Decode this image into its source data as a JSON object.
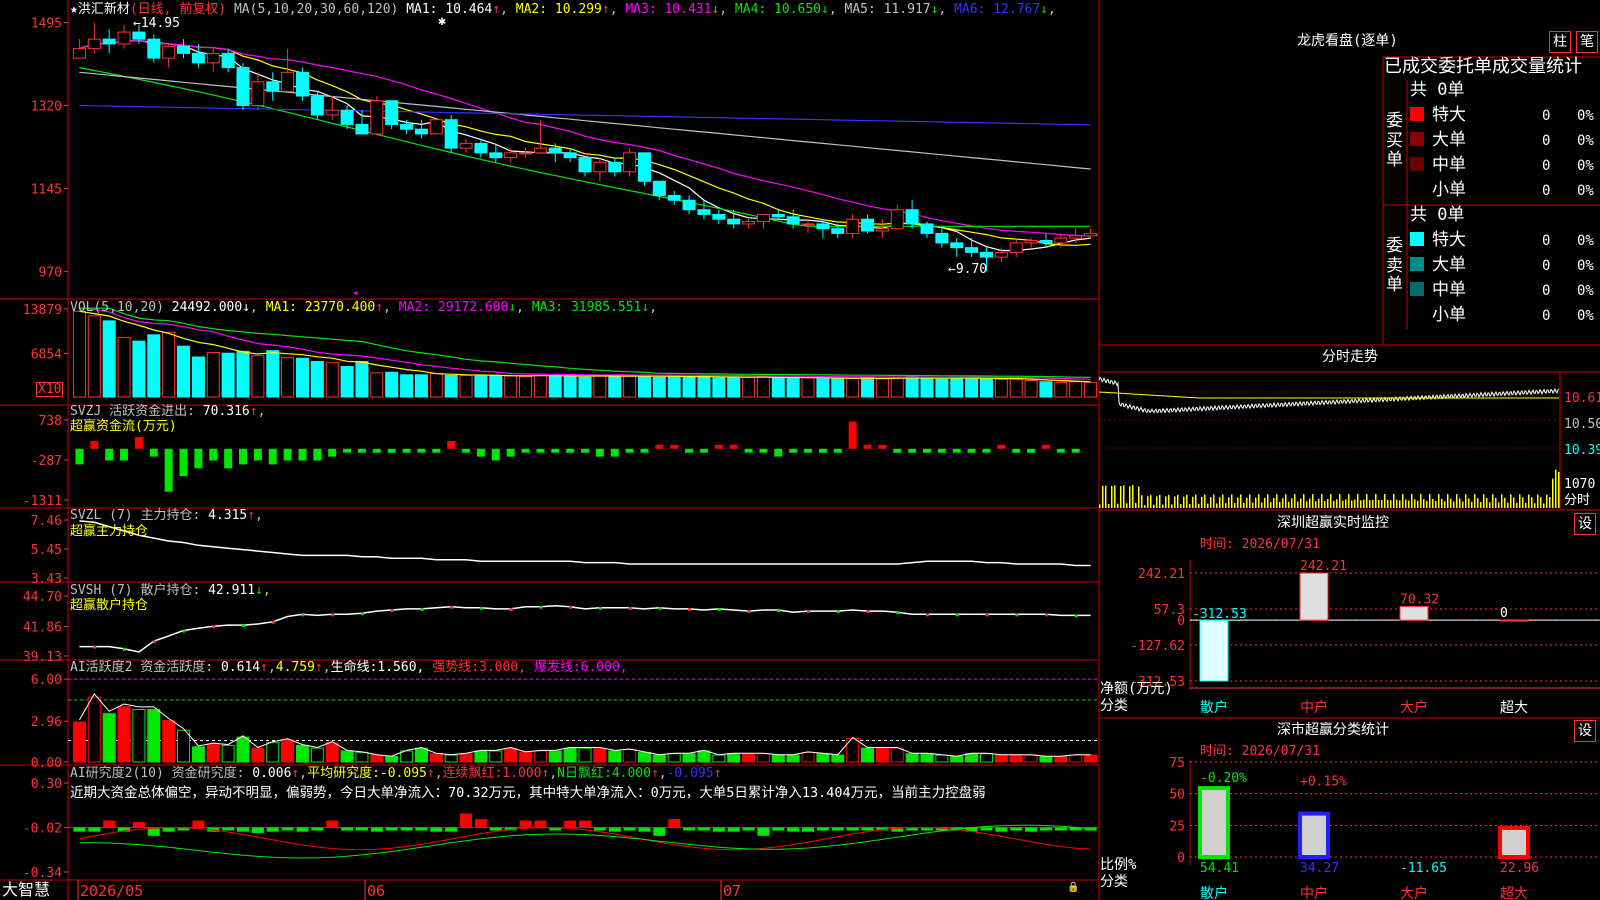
{
  "stock": {
    "star": "★",
    "name": "洪汇新材",
    "mode": "(日线, 前复权)"
  },
  "ma_header": {
    "label": "MA(5,10,20,30,60,120)",
    "items": [
      {
        "name": "MA1:",
        "value": "10.464",
        "dir": "↑",
        "color": "#ffffff"
      },
      {
        "name": "MA2:",
        "value": "10.299",
        "dir": "↑",
        "color": "#ffff00"
      },
      {
        "name": "MA3:",
        "value": "10.431",
        "dir": "↓",
        "color": "#ff00ff"
      },
      {
        "name": "MA4:",
        "value": "10.650",
        "dir": "↓",
        "color": "#00e600"
      },
      {
        "name": "MA5:",
        "value": "11.917",
        "dir": "↓",
        "color": "#c0c0c0"
      },
      {
        "name": "MA6:",
        "value": "12.767",
        "dir": "↓",
        "color": "#3232ff"
      }
    ]
  },
  "price_axis": [
    "1495",
    "1320",
    "1145",
    "970"
  ],
  "price_marks": {
    "high": "14.95",
    "low": "9.70"
  },
  "vol_header": {
    "label": "VOL(5,10,20)",
    "value": "24492.000",
    "dir": "↓",
    "items": [
      {
        "name": "MA1:",
        "value": "23770.400",
        "dir": "↑",
        "color": "#ffff00"
      },
      {
        "name": "MA2:",
        "value": "29172.600",
        "dir": "↓",
        "color": "#ff00ff"
      },
      {
        "name": "MA3:",
        "value": "31985.551",
        "dir": "↓",
        "color": "#00e600"
      }
    ]
  },
  "vol_axis": [
    "13879",
    "6854"
  ],
  "vol_unit": "X10",
  "svzj": {
    "label": "SVZJ  活跃资金进出:",
    "value": "70.316",
    "dir": "↑",
    "sub": "超赢资金流(万元)",
    "axis": [
      "738",
      "-287",
      "-1311"
    ]
  },
  "svzl": {
    "label": "SVZL (7) 主力持仓:",
    "value": "4.315",
    "dir": "↑",
    "sub": "超赢主力持仓",
    "axis": [
      "7.46",
      "5.45",
      "3.43"
    ]
  },
  "svsh": {
    "label": "SVSH (7) 散户持仓:",
    "value": "42.911",
    "dir": "↓",
    "sub": "超赢散户持仓",
    "axis": [
      "44.70",
      "41.86",
      "39.13"
    ]
  },
  "ai1": {
    "label": "AI活跃度2 资金活跃度:",
    "v1": "0.614",
    "v2": "4.759",
    "life": "生命线:",
    "life_v": "1.560,",
    "strong": "强势线:",
    "strong_v": "3.000,",
    "burst": "爆发线:",
    "burst_v": "6.000,",
    "axis": [
      "6.00",
      "2.96",
      "0.00"
    ]
  },
  "ai2": {
    "label": "AI研究度2(10) 资金研究度:",
    "v1": "0.006",
    "avg": "平均研究度:",
    "avg_v": "-0.095",
    "lx": "连续飘红:",
    "lx_v": "1.000",
    "nd": "N日飘红:",
    "nd_v": "4.000",
    "last": "-0.095",
    "axis": [
      "0.30",
      "-0.02",
      "-0.34"
    ],
    "comment": "近期大资金总体偏空，异动不明显，偏弱势，今日大单净流入：70.32万元，其中特大单净流入：0万元，大单5日累计净入13.404万元，当前主力控盘弱"
  },
  "dates": [
    "2026/05",
    "06",
    "07"
  ],
  "brand": "大智慧",
  "lhb": {
    "title": "龙虎看盘(逐单)",
    "btn1": "柱",
    "btn2": "笔",
    "tabs": "已成交委托单成交量统计",
    "buy": {
      "side": "委买单",
      "total": "共 0单",
      "rows": [
        {
          "label": "特大",
          "n": "0",
          "p": "0%",
          "color": "#ff0000"
        },
        {
          "label": "大单",
          "n": "0",
          "p": "0%",
          "color": "#8b0000"
        },
        {
          "label": "中单",
          "n": "0",
          "p": "0%",
          "color": "#6b0000"
        },
        {
          "label": "小单",
          "n": "0",
          "p": "0%",
          "color": "#000000"
        }
      ]
    },
    "sell": {
      "side": "委卖单",
      "total": "共 0单",
      "rows": [
        {
          "label": "特大",
          "n": "0",
          "p": "0%",
          "color": "#00ffff"
        },
        {
          "label": "大单",
          "n": "0",
          "p": "0%",
          "color": "#008b8b"
        },
        {
          "label": "中单",
          "n": "0",
          "p": "0%",
          "color": "#006b6b"
        },
        {
          "label": "小单",
          "n": "0",
          "p": "0%",
          "color": "#000000"
        }
      ]
    }
  },
  "fenshi": {
    "title": "分时走势",
    "axis": [
      "10.61",
      "10.50",
      "10.39"
    ],
    "vol": "1070",
    "vol_label": "分时"
  },
  "szjk": {
    "title": "深圳超赢实时监控",
    "btn": "设",
    "time": "时间: 2026/07/31",
    "axis": [
      "242.21",
      "57.3",
      "0",
      "-127.62",
      "-312.53"
    ],
    "unit": "净额(万元)",
    "cat_label": "分类",
    "categories": [
      "散户",
      "中户",
      "大户",
      "超大"
    ],
    "values": [
      "-312.53",
      "242.21",
      "70.32",
      "0"
    ]
  },
  "szfl": {
    "title": "深市超赢分类统计",
    "btn": "设",
    "time": "时间: 2026/07/31",
    "axis": [
      "75",
      "50",
      "25",
      "0"
    ],
    "unit": "比例%",
    "cat_label": "分类",
    "categories": [
      "散户",
      "中户",
      "大户",
      "超大"
    ],
    "values": [
      "54.41",
      "34.27",
      "-11.65",
      "22.96"
    ],
    "changes": [
      "-0.20%",
      "+0.15%"
    ]
  },
  "chart_data": [
    {
      "type": "candlestick",
      "title": "洪汇新材 (日线, 前复权)",
      "ylim": [
        9.2,
        15.3
      ],
      "series": [
        {
          "name": "MA1",
          "color": "#ffffff",
          "last": 10.464
        },
        {
          "name": "MA2",
          "color": "#ffff00",
          "last": 10.299
        },
        {
          "name": "MA3",
          "color": "#ff00ff",
          "last": 10.431
        },
        {
          "name": "MA4",
          "color": "#00e600",
          "last": 10.65
        },
        {
          "name": "MA5",
          "color": "#c0c0c0",
          "last": 11.917
        },
        {
          "name": "MA6",
          "color": "#3232ff",
          "last": 12.767
        }
      ],
      "high": 14.95,
      "low": 9.7,
      "ohlc": [
        [
          14.2,
          14.6,
          14.3,
          14.4
        ],
        [
          14.4,
          14.95,
          14.3,
          14.6
        ],
        [
          14.6,
          14.8,
          14.3,
          14.5
        ],
        [
          14.5,
          14.9,
          14.4,
          14.75
        ],
        [
          14.75,
          14.9,
          14.5,
          14.6
        ],
        [
          14.6,
          14.7,
          14.1,
          14.2
        ],
        [
          14.2,
          14.5,
          14.0,
          14.45
        ],
        [
          14.45,
          14.6,
          14.2,
          14.3
        ],
        [
          14.3,
          14.5,
          14.0,
          14.1
        ],
        [
          14.1,
          14.4,
          13.9,
          14.3
        ],
        [
          14.3,
          14.4,
          13.9,
          14.0
        ],
        [
          14.0,
          14.1,
          13.1,
          13.2
        ],
        [
          13.2,
          13.9,
          13.1,
          13.7
        ],
        [
          13.7,
          13.9,
          13.3,
          13.5
        ],
        [
          13.5,
          14.4,
          13.5,
          13.9
        ],
        [
          13.9,
          14.0,
          13.3,
          13.4
        ],
        [
          13.4,
          13.5,
          12.9,
          13.0
        ],
        [
          13.0,
          13.4,
          12.9,
          13.1
        ],
        [
          13.1,
          13.2,
          12.7,
          12.8
        ],
        [
          12.8,
          13.1,
          12.6,
          12.6
        ],
        [
          12.6,
          13.4,
          12.6,
          13.3
        ],
        [
          13.3,
          13.3,
          12.7,
          12.8
        ],
        [
          12.8,
          12.9,
          12.6,
          12.7
        ],
        [
          12.7,
          12.9,
          12.5,
          12.6
        ],
        [
          12.6,
          12.9,
          12.6,
          12.9
        ],
        [
          12.9,
          13.0,
          12.2,
          12.3
        ],
        [
          12.3,
          12.5,
          12.2,
          12.4
        ],
        [
          12.4,
          12.5,
          12.1,
          12.2
        ],
        [
          12.2,
          12.4,
          12.0,
          12.1
        ],
        [
          12.1,
          12.3,
          12.0,
          12.2
        ],
        [
          12.2,
          12.3,
          12.1,
          12.2
        ],
        [
          12.2,
          12.9,
          12.2,
          12.3
        ],
        [
          12.3,
          12.4,
          12.0,
          12.2
        ],
        [
          12.2,
          12.3,
          12.0,
          12.1
        ],
        [
          12.1,
          12.1,
          11.7,
          11.8
        ],
        [
          11.8,
          12.1,
          11.6,
          12.0
        ],
        [
          12.0,
          12.1,
          11.7,
          11.8
        ],
        [
          11.8,
          12.3,
          11.7,
          12.2
        ],
        [
          12.2,
          12.2,
          11.5,
          11.6
        ],
        [
          11.6,
          11.6,
          11.2,
          11.3
        ],
        [
          11.3,
          11.4,
          11.1,
          11.2
        ],
        [
          11.2,
          11.3,
          10.9,
          11.0
        ],
        [
          11.0,
          11.2,
          10.8,
          10.9
        ],
        [
          10.9,
          11.0,
          10.7,
          10.8
        ],
        [
          10.8,
          11.0,
          10.6,
          10.7
        ],
        [
          10.7,
          10.8,
          10.6,
          10.75
        ],
        [
          10.75,
          10.9,
          10.6,
          10.9
        ],
        [
          10.9,
          11.0,
          10.8,
          10.85
        ],
        [
          10.85,
          11.0,
          10.6,
          10.7
        ],
        [
          10.7,
          10.8,
          10.5,
          10.7
        ],
        [
          10.7,
          10.8,
          10.4,
          10.6
        ],
        [
          10.6,
          10.7,
          10.4,
          10.5
        ],
        [
          10.5,
          10.9,
          10.4,
          10.8
        ],
        [
          10.8,
          10.9,
          10.5,
          10.55
        ],
        [
          10.55,
          10.8,
          10.4,
          10.6
        ],
        [
          10.6,
          11.1,
          10.6,
          11.0
        ],
        [
          11.0,
          11.2,
          10.6,
          10.7
        ],
        [
          10.7,
          10.75,
          10.4,
          10.5
        ],
        [
          10.5,
          10.6,
          10.2,
          10.3
        ],
        [
          10.3,
          10.4,
          10.0,
          10.2
        ],
        [
          10.2,
          10.4,
          10.0,
          10.1
        ],
        [
          10.1,
          10.2,
          9.7,
          10.0
        ],
        [
          10.0,
          10.2,
          9.9,
          10.1
        ],
        [
          10.1,
          10.4,
          10.0,
          10.3
        ],
        [
          10.3,
          10.4,
          10.2,
          10.35
        ],
        [
          10.35,
          10.5,
          10.2,
          10.3
        ],
        [
          10.3,
          10.5,
          10.2,
          10.4
        ],
        [
          10.4,
          10.6,
          10.3,
          10.45
        ],
        [
          10.45,
          10.6,
          10.4,
          10.5
        ]
      ]
    },
    {
      "type": "bar",
      "title": "VOL(5,10,20)",
      "ylim": [
        0,
        14500
      ],
      "series": [
        {
          "name": "MA1",
          "value": 23770.4
        },
        {
          "name": "MA2",
          "value": 29172.6
        },
        {
          "name": "MA3",
          "value": 31985.551
        }
      ],
      "values": [
        13500,
        12800,
        12000,
        9400,
        8800,
        9800,
        10200,
        8000,
        6300,
        7000,
        6900,
        7200,
        6500,
        7300,
        6200,
        6100,
        5600,
        5400,
        4800,
        5600,
        3800,
        3900,
        3500,
        3500,
        3700,
        3400,
        3400,
        3300,
        3400,
        3300,
        3200,
        3600,
        3300,
        3200,
        3100,
        3400,
        3400,
        3300,
        3200,
        3100,
        3300,
        3200,
        3300,
        3000,
        3000,
        3100,
        3200,
        3100,
        3000,
        3000,
        2900,
        2900,
        2900,
        3000,
        2900,
        3000,
        3200,
        2900,
        2800,
        3100,
        3000,
        2900,
        2800,
        2800,
        2600,
        2400,
        2300,
        2400,
        2300
      ]
    },
    {
      "type": "bar",
      "title": "超赢资金流(万元)",
      "ylim": [
        -1311,
        738
      ],
      "values": [
        -400,
        200,
        -300,
        -300,
        300,
        -200,
        -1100,
        -700,
        -500,
        -300,
        -500,
        -400,
        -300,
        -400,
        -300,
        -300,
        -300,
        -200,
        -100,
        -100,
        -100,
        -100,
        -100,
        -100,
        -100,
        200,
        -100,
        -200,
        -300,
        -200,
        -100,
        -100,
        -100,
        -100,
        -100,
        -200,
        -200,
        -100,
        -100,
        100,
        100,
        -100,
        -100,
        100,
        100,
        -100,
        -100,
        -200,
        -100,
        -100,
        -100,
        -100,
        700,
        100,
        100,
        -100,
        -100,
        -100,
        -100,
        -100,
        -100,
        -100,
        100,
        -100,
        -100,
        100,
        -100,
        -100
      ]
    },
    {
      "type": "line",
      "title": "超赢主力持仓",
      "ylim": [
        3.43,
        7.46
      ],
      "values": [
        7.4,
        7.3,
        7.0,
        6.7,
        6.4,
        6.2,
        6.0,
        5.9,
        5.7,
        5.6,
        5.5,
        5.4,
        5.3,
        5.2,
        5.1,
        5.0,
        5.0,
        5.0,
        5.0,
        4.9,
        4.9,
        4.8,
        4.8,
        4.8,
        4.7,
        4.7,
        4.7,
        4.6,
        4.6,
        4.6,
        4.6,
        4.6,
        4.6,
        4.6,
        4.5,
        4.5,
        4.5,
        4.4,
        4.4,
        4.4,
        4.4,
        4.4,
        4.4,
        4.4,
        4.4,
        4.4,
        4.4,
        4.4,
        4.4,
        4.4,
        4.4,
        4.4,
        4.4,
        4.4,
        4.4,
        4.4,
        4.5,
        4.6,
        4.6,
        4.6,
        4.6,
        4.5,
        4.5,
        4.4,
        4.4,
        4.4,
        4.4,
        4.3,
        4.3
      ]
    },
    {
      "type": "line",
      "title": "超赢散户持仓",
      "ylim": [
        39.13,
        44.7
      ],
      "values": [
        40.0,
        40.0,
        40.0,
        39.8,
        39.5,
        40.5,
        41.0,
        41.5,
        41.7,
        41.9,
        42.0,
        42.0,
        42.1,
        42.3,
        42.8,
        43.0,
        42.9,
        43.0,
        43.0,
        43.1,
        43.3,
        43.4,
        43.5,
        43.5,
        43.6,
        43.7,
        43.6,
        43.6,
        43.5,
        43.5,
        43.7,
        43.7,
        43.8,
        43.7,
        43.5,
        43.6,
        43.6,
        43.6,
        43.5,
        43.6,
        43.5,
        43.5,
        43.4,
        43.5,
        43.4,
        43.3,
        43.4,
        43.4,
        43.2,
        43.3,
        43.3,
        43.3,
        43.4,
        43.3,
        43.3,
        43.2,
        43.0,
        43.0,
        43.0,
        43.0,
        43.0,
        43.0,
        43.0,
        43.0,
        43.0,
        43.0,
        42.9,
        42.9,
        42.9
      ]
    },
    {
      "type": "bar",
      "title": "AI活跃度2",
      "ylim": [
        0,
        6.3
      ],
      "values": [
        2.9,
        4.7,
        3.5,
        4.0,
        3.8,
        3.8,
        3.0,
        2.3,
        1.1,
        1.3,
        1.2,
        1.8,
        1.0,
        1.4,
        1.6,
        1.2,
        1.0,
        1.4,
        0.8,
        0.7,
        0.5,
        0.4,
        0.8,
        1.0,
        0.6,
        0.5,
        0.6,
        0.8,
        0.8,
        1.0,
        0.7,
        0.8,
        0.8,
        1.0,
        1.0,
        1.0,
        0.8,
        0.9,
        0.7,
        0.5,
        0.6,
        0.6,
        0.8,
        0.5,
        0.6,
        0.6,
        0.6,
        0.5,
        0.5,
        0.7,
        0.6,
        0.5,
        1.7,
        1.0,
        1.0,
        1.0,
        0.6,
        0.6,
        0.5,
        0.4,
        0.6,
        0.6,
        0.5,
        0.5,
        0.5,
        0.4,
        0.4,
        0.5,
        0.5
      ]
    },
    {
      "type": "bar",
      "title": "AI研究度2(10)",
      "ylim": [
        -0.34,
        0.3
      ],
      "values": [
        -0.05,
        -0.05,
        0.03,
        -0.05,
        0.02,
        -0.08,
        -0.05,
        -0.04,
        0.03,
        -0.05,
        -0.04,
        -0.05,
        -0.06,
        -0.05,
        -0.04,
        -0.05,
        -0.04,
        0.03,
        -0.04,
        -0.04,
        -0.05,
        -0.03,
        -0.04,
        -0.04,
        -0.05,
        -0.05,
        0.08,
        0.04,
        -0.04,
        -0.04,
        0.03,
        0.03,
        -0.04,
        0.03,
        0.03,
        -0.04,
        -0.05,
        -0.04,
        -0.05,
        -0.08,
        0.04,
        -0.04,
        -0.04,
        -0.05,
        -0.05,
        -0.04,
        -0.08,
        -0.04,
        -0.05,
        -0.05,
        -0.04,
        -0.04,
        -0.04,
        -0.04,
        -0.04,
        -0.05,
        -0.04,
        -0.03,
        -0.04,
        -0.04,
        -0.05,
        -0.04,
        -0.05,
        -0.04,
        -0.05,
        -0.04,
        -0.04,
        -0.04,
        -0.04
      ]
    }
  ]
}
